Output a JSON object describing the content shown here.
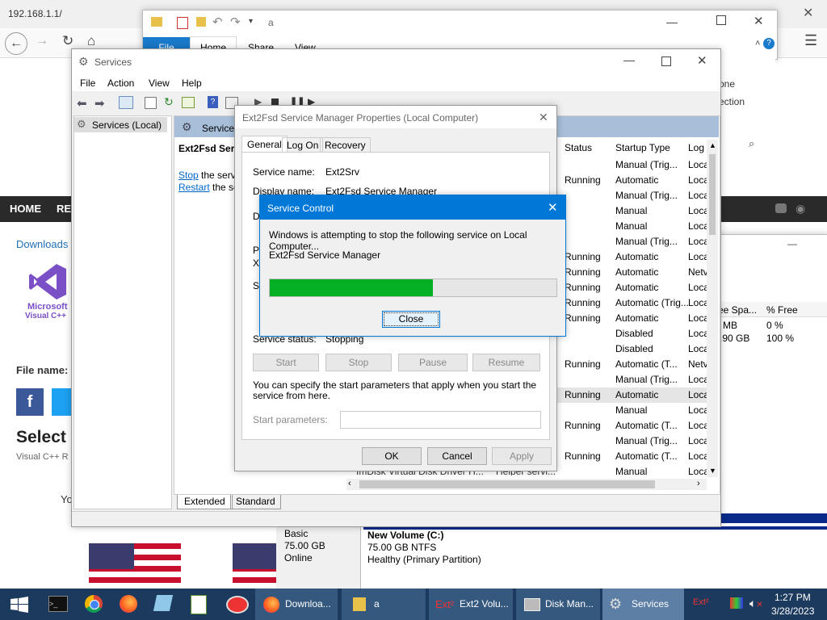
{
  "browser": {
    "address": "192.168.1.1/",
    "page": {
      "nav": [
        "HOME",
        "REV"
      ],
      "downloads_crumb": "Downloads",
      "logo_line1": "Microsoft",
      "logo_line2": "Visual C++",
      "file_name_label": "File name:",
      "select_heading": "Select",
      "visual_cpp_label": "Visual C++ R",
      "yo_text": "Yo"
    }
  },
  "explorer": {
    "title": "a",
    "tabs": [
      "File",
      "Home",
      "Share",
      "View"
    ],
    "side_text_1": "one",
    "side_text_2": "ection"
  },
  "services": {
    "title": "Services",
    "menu": [
      "File",
      "Action",
      "View",
      "Help"
    ],
    "tree_item": "Services (Local)",
    "panel_header": "Services",
    "selected_name": "Ext2Fsd Serv",
    "stop_link": "Stop",
    "stop_rest": " the servi",
    "restart_link": "Restart",
    "restart_rest": " the se",
    "columns": {
      "status": "Status",
      "startup": "Startup Type",
      "log": "Log"
    },
    "rows": [
      {
        "status": "",
        "startup": "Manual (Trig...",
        "log": "Loca"
      },
      {
        "status": "Running",
        "startup": "Automatic",
        "log": "Loca"
      },
      {
        "status": "",
        "startup": "Manual (Trig...",
        "log": "Loca"
      },
      {
        "status": "",
        "startup": "Manual",
        "log": "Loca"
      },
      {
        "status": "",
        "startup": "Manual",
        "log": "Loca"
      },
      {
        "status": "",
        "startup": "Manual (Trig...",
        "log": "Loca"
      },
      {
        "status": "Running",
        "startup": "Automatic",
        "log": "Loca"
      },
      {
        "status": "Running",
        "startup": "Automatic",
        "log": "Netv"
      },
      {
        "status": "Running",
        "startup": "Automatic",
        "log": "Loca"
      },
      {
        "status": "Running",
        "startup": "Automatic (Trig...",
        "log": "Loca"
      },
      {
        "status": "Running",
        "startup": "Automatic",
        "log": "Loca"
      },
      {
        "status": "",
        "startup": "Disabled",
        "log": "Loca"
      },
      {
        "status": "",
        "startup": "Disabled",
        "log": "Loca"
      },
      {
        "status": "Running",
        "startup": "Automatic (T...",
        "log": "Netv"
      },
      {
        "status": "",
        "startup": "Manual (Trig...",
        "log": "Loca"
      },
      {
        "status": "Running",
        "startup": "Automatic",
        "log": "Loca"
      },
      {
        "status": "",
        "startup": "Manual",
        "log": "Loca"
      },
      {
        "status": "Running",
        "startup": "Automatic (T...",
        "log": "Loca"
      },
      {
        "status": "",
        "startup": "Manual (Trig...",
        "log": "Loca"
      },
      {
        "status": "Running",
        "startup": "Automatic (T...",
        "log": "Loca"
      },
      {
        "status": "",
        "startup": "Manual",
        "log": "Loca"
      }
    ],
    "last_row_name": "ImDisk Virtual Disk Driver H...",
    "last_row_desc": "Helper servi...",
    "bottom_tabs": [
      "Extended",
      "Standard"
    ]
  },
  "props": {
    "title": "Ext2Fsd Service Manager Properties (Local Computer)",
    "tabs": [
      "General",
      "Log On",
      "Recovery"
    ],
    "service_name_label": "Service name:",
    "service_name_value": "Ext2Srv",
    "display_name_label": "Display name:",
    "display_name_value": "Ext2Fsd Service Manager",
    "frag_d": "De",
    "frag_p": "Pa",
    "frag_x": "X:",
    "frag_s": "St",
    "status_label": "Service status:",
    "status_value": "Stopping",
    "btn_start": "Start",
    "btn_stop": "Stop",
    "btn_pause": "Pause",
    "btn_resume": "Resume",
    "hint": "You can specify the start parameters that apply when you start the service from here.",
    "start_params_label": "Start parameters:",
    "ok": "OK",
    "cancel": "Cancel",
    "apply": "Apply"
  },
  "service_control": {
    "title": "Service Control",
    "message": "Windows is attempting to stop the following service on Local Computer...",
    "service": "Ext2Fsd Service Manager",
    "progress": 0.57,
    "close": "Close"
  },
  "disk": {
    "col_free": "ee Spa...",
    "col_pct": "% Free",
    "r1_free": "MB",
    "r1_pct": "0 %",
    "r2_free": ".90 GB",
    "r2_pct": "100 %",
    "basic": "Basic",
    "size": "75.00 GB",
    "online": "Online",
    "vol_name": "New Volume  (C:)",
    "vol_fs": "75.00 GB NTFS",
    "vol_health": "Healthy (Primary Partition)"
  },
  "taskbar": {
    "items": [
      "Downloa...",
      "a",
      "Ext2 Volu...",
      "Disk Man...",
      "Services"
    ],
    "time": "1:27 PM",
    "date": "3/28/2023"
  },
  "colors": {
    "accent": "#0078d7",
    "progress": "#06b025",
    "taskbar": "#1c3a5e"
  }
}
